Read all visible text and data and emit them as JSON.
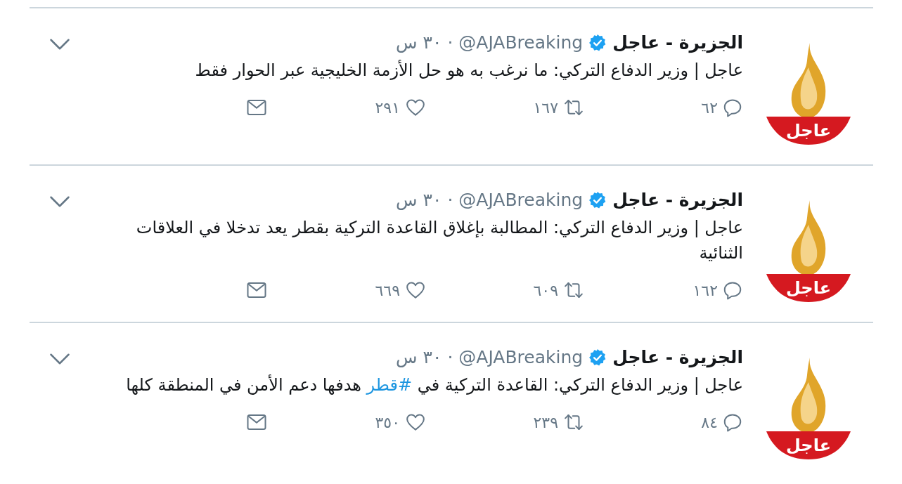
{
  "tweets": [
    {
      "avatar": {
        "label": "عاجل"
      },
      "name": "الجزيرة - عاجل",
      "verified": true,
      "handle": "@AJABreaking",
      "separator": "·",
      "time": "٣٠ س",
      "text": [
        {
          "kind": "plain",
          "text": "عاجل | وزير الدفاع التركي: ما نرغب به هو حل الأزمة الخليجية عبر الحوار فقط"
        }
      ],
      "replies": "٦٢",
      "retweets": "١٦٧",
      "likes": "٢٩١"
    },
    {
      "avatar": {
        "label": "عاجل"
      },
      "name": "الجزيرة - عاجل",
      "verified": true,
      "handle": "@AJABreaking",
      "separator": "·",
      "time": "٣٠ س",
      "text": [
        {
          "kind": "plain",
          "text": "عاجل | وزير الدفاع التركي: المطالبة بإغلاق القاعدة التركية بقطر يعد تدخلا في العلاقات الثنائية"
        }
      ],
      "replies": "١٦٢",
      "retweets": "٦٠٩",
      "likes": "٦٦٩"
    },
    {
      "avatar": {
        "label": "عاجل"
      },
      "name": "الجزيرة - عاجل",
      "verified": true,
      "handle": "@AJABreaking",
      "separator": "·",
      "time": "٣٠ س",
      "text": [
        {
          "kind": "plain",
          "text": "عاجل | وزير الدفاع التركي: القاعدة التركية في "
        },
        {
          "kind": "hashtag",
          "text": "#قطر"
        },
        {
          "kind": "plain",
          "text": " هدفها دعم الأمن في المنطقة كلها"
        }
      ],
      "replies": "٨٤",
      "retweets": "٢٣٩",
      "likes": "٣٥٠"
    }
  ]
}
